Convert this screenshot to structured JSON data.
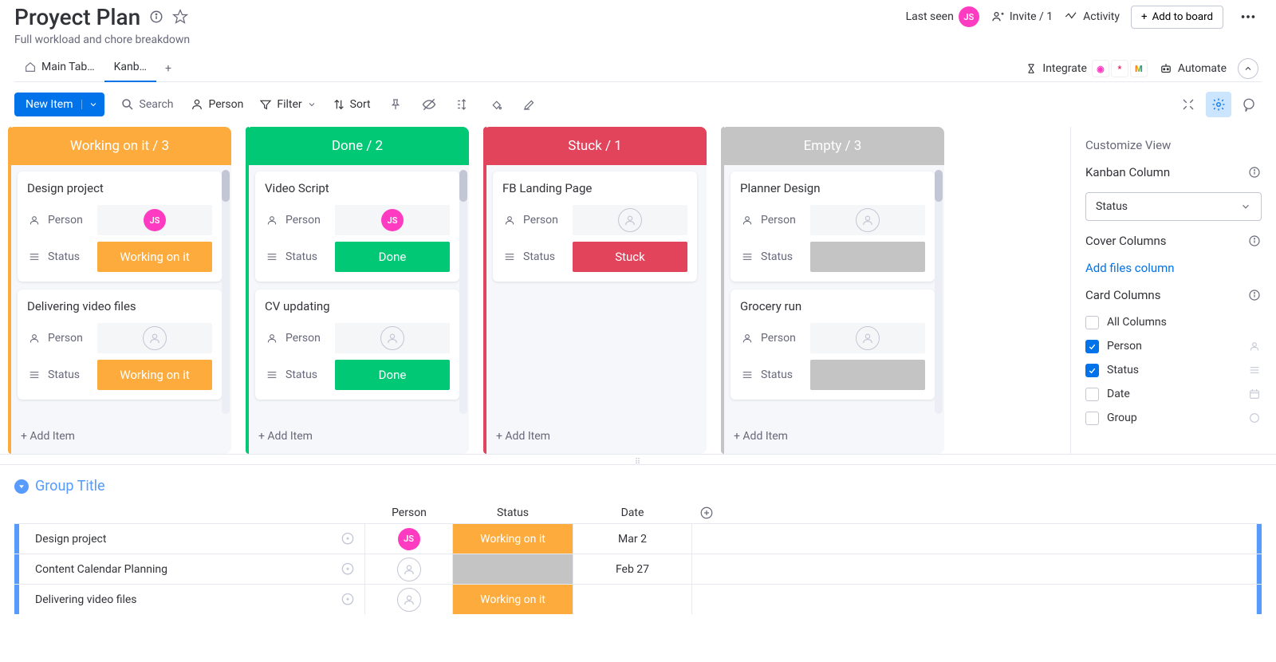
{
  "header": {
    "title": "Proyect Plan",
    "subtitle": "Full workload and chore breakdown",
    "lastseen_label": "Last seen",
    "avatar_initials": "JS",
    "invite_label": "Invite / 1",
    "activity_label": "Activity",
    "add_to_board_label": "Add to board"
  },
  "tabs": {
    "items": [
      {
        "label": "Main Tab…"
      },
      {
        "label": "Kanb…"
      }
    ],
    "integrate_label": "Integrate",
    "automate_label": "Automate"
  },
  "toolbar": {
    "new_item_label": "New Item",
    "search_placeholder": "Search",
    "person_label": "Person",
    "filter_label": "Filter",
    "sort_label": "Sort"
  },
  "colors": {
    "working": "#fdab3d",
    "done": "#00c875",
    "stuck": "#e2445c",
    "empty": "#c4c4c4",
    "blue_accent": "#579bfc",
    "primary": "#0073ea",
    "avatar_pink": "#ff3bc1"
  },
  "columns": [
    {
      "title": "Working on it / 3",
      "color": "working",
      "has_scrollbar": true,
      "cards": [
        {
          "title": "Design project",
          "person": {
            "type": "avatar",
            "initials": "JS"
          },
          "status": {
            "label": "Working on it",
            "color": "working"
          }
        },
        {
          "title": "Delivering video files",
          "person": {
            "type": "empty"
          },
          "status": {
            "label": "Working on it",
            "color": "working"
          }
        }
      ],
      "add_item_label": "+ Add Item"
    },
    {
      "title": "Done / 2",
      "color": "done",
      "has_scrollbar": true,
      "cards": [
        {
          "title": "Video Script",
          "person": {
            "type": "avatar",
            "initials": "JS"
          },
          "status": {
            "label": "Done",
            "color": "done"
          }
        },
        {
          "title": "CV updating",
          "person": {
            "type": "empty"
          },
          "status": {
            "label": "Done",
            "color": "done"
          }
        }
      ],
      "add_item_label": "+ Add Item"
    },
    {
      "title": "Stuck / 1",
      "color": "stuck",
      "has_scrollbar": false,
      "cards": [
        {
          "title": "FB Landing Page",
          "person": {
            "type": "empty"
          },
          "status": {
            "label": "Stuck",
            "color": "stuck"
          }
        }
      ],
      "add_item_label": "+ Add Item"
    },
    {
      "title": "Empty / 3",
      "color": "empty",
      "has_scrollbar": true,
      "cards": [
        {
          "title": "Planner Design",
          "person": {
            "type": "empty"
          },
          "status": {
            "label": "",
            "color": "empty"
          }
        },
        {
          "title": "Grocery run",
          "person": {
            "type": "empty"
          },
          "status": {
            "label": "",
            "color": "empty"
          }
        }
      ],
      "add_item_label": "+ Add Item"
    }
  ],
  "side": {
    "title": "Customize View",
    "kanban_column_label": "Kanban Column",
    "select_value": "Status",
    "cover_columns_label": "Cover Columns",
    "add_files_link": "Add files column",
    "card_columns_label": "Card Columns",
    "options": [
      {
        "label": "All Columns",
        "checked": false,
        "icon": "none"
      },
      {
        "label": "Person",
        "checked": true,
        "icon": "person"
      },
      {
        "label": "Status",
        "checked": true,
        "icon": "status"
      },
      {
        "label": "Date",
        "checked": false,
        "icon": "date"
      },
      {
        "label": "Group",
        "checked": false,
        "icon": "group"
      }
    ]
  },
  "table": {
    "group_title": "Group Title",
    "headers": {
      "person": "Person",
      "status": "Status",
      "date": "Date"
    },
    "rows": [
      {
        "name": "Design project",
        "person": {
          "type": "avatar",
          "initials": "JS"
        },
        "status": {
          "label": "Working on it",
          "color": "working"
        },
        "date": "Mar 2"
      },
      {
        "name": "Content Calendar Planning",
        "person": {
          "type": "empty"
        },
        "status": {
          "label": "",
          "color": "empty"
        },
        "date": "Feb 27"
      },
      {
        "name": "Delivering video files",
        "person": {
          "type": "empty"
        },
        "status": {
          "label": "Working on it",
          "color": "working"
        },
        "date": ""
      }
    ]
  },
  "labels": {
    "person": "Person",
    "status": "Status"
  }
}
